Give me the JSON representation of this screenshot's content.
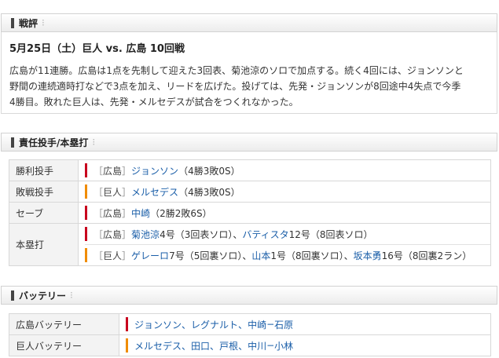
{
  "sections": {
    "game": {
      "title": "戦評"
    },
    "pitchers": {
      "title": "責任投手/本塁打"
    },
    "battery": {
      "title": "バッテリー"
    }
  },
  "game": {
    "headline": "5月25日（土）巨人 vs. 広島 10回戦",
    "summary_line1": "広島が11連勝。広島は1点を先制して迎えた3回表、菊池涼のソロで加点する。続く4回には、ジョンソンと",
    "summary_line2": "野間の連続適時打などで3点を加え、リードを広げた。投げては、先発・ジョンソンが8回途中4失点で今季",
    "summary_line3": "4勝目。敗れた巨人は、先発・メルセデスが試合をつくれなかった。"
  },
  "pitchers": {
    "win": {
      "label": "勝利投手",
      "team": "広島",
      "name": "ジョンソン",
      "record": "（4勝3敗0S）"
    },
    "loss": {
      "label": "敗戦投手",
      "team": "巨人",
      "name": "メルセデス",
      "record": "（4勝3敗0S）"
    },
    "save": {
      "label": "セーブ",
      "team": "広島",
      "name": "中崎",
      "record": "（2勝2敗6S）"
    },
    "homeruns": {
      "label": "本塁打",
      "hiroshima": {
        "team": "広島",
        "p1_name": "菊池涼",
        "p1_info": "4号（3回表ソロ）、",
        "p2_name": "バティスタ",
        "p2_info": "12号（8回表ソロ）"
      },
      "giants": {
        "team": "巨人",
        "p1_name": "ゲレーロ",
        "p1_info": "7号（5回裏ソロ）、",
        "p2_name": "山本",
        "p2_info": "1号（8回裏ソロ）、",
        "p3_name": "坂本勇",
        "p3_info": "16号（8回裏2ラン）"
      }
    }
  },
  "battery": {
    "hiroshima": {
      "label": "広島バッテリー",
      "p1": "ジョンソン",
      "sep1": "、",
      "p2": "レグナルト",
      "sep2": "、",
      "p3": "中崎",
      "dash": " − ",
      "c1": "石原"
    },
    "giants": {
      "label": "巨人バッテリー",
      "p1": "メルセデス",
      "sep1": "、",
      "p2": "田口",
      "sep2": "、",
      "p3": "戸根",
      "sep3": "、",
      "p4": "中川",
      "dash": " − ",
      "c1": "小林"
    }
  },
  "colors": {
    "hiroshima": "#c8001e",
    "giants": "#f08c00",
    "link": "#1a5ea8"
  }
}
